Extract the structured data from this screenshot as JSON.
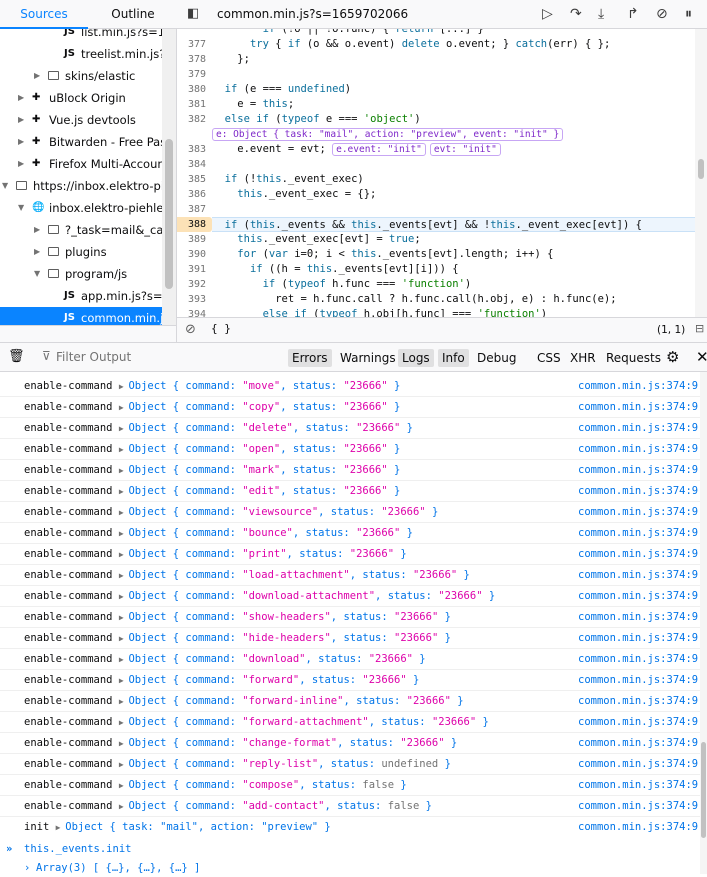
{
  "sidebar": {
    "tabs": {
      "sources": "Sources",
      "outline": "Outline"
    },
    "tree": [
      {
        "label": "list.min.js?s=1",
        "type": "js",
        "depth": 4
      },
      {
        "label": "treelist.min.js?",
        "type": "js",
        "depth": 4
      },
      {
        "label": "skins/elastic",
        "type": "folder",
        "depth": 3
      },
      {
        "label": "uBlock Origin",
        "type": "ext",
        "depth": 2
      },
      {
        "label": "Vue.js devtools",
        "type": "ext",
        "depth": 2
      },
      {
        "label": "Bitwarden - Free Pass",
        "type": "ext",
        "depth": 2
      },
      {
        "label": "Firefox Multi-Accoun",
        "type": "ext",
        "depth": 2
      },
      {
        "label": "https://inbox.elektro-pie",
        "type": "page",
        "depth": 1
      },
      {
        "label": "inbox.elektro-piehler",
        "type": "globe",
        "depth": 2
      },
      {
        "label": "?_task=mail&_cap",
        "type": "folder",
        "depth": 3
      },
      {
        "label": "plugins",
        "type": "folder",
        "depth": 3
      },
      {
        "label": "program/js",
        "type": "folder",
        "depth": 3
      },
      {
        "label": "app.min.js?s=1",
        "type": "js",
        "depth": 4
      },
      {
        "label": "common.min.js",
        "type": "js",
        "depth": 4,
        "selected": true
      }
    ]
  },
  "editor": {
    "file_tab": "common.min.js?s=1659702066",
    "footer_braces": "{ }",
    "cursor_pos": "(1, 1)",
    "lines": [
      {
        "n": "",
        "html": "        <span class='kw'>if</span> (!o || !o.func) { <span class='kw'>return</span> [...] }"
      },
      {
        "n": "377",
        "html": "      <span class='kw'>try</span> { <span class='kw'>if</span> (o && o.event) <span class='kw'>delete</span> o.event; } <span class='kw'>catch</span>(err) { };"
      },
      {
        "n": "378",
        "html": "    };"
      },
      {
        "n": "379",
        "html": ""
      },
      {
        "n": "380",
        "html": "  <span class='kw'>if</span> (e === <span class='kw'>undefined</span>)"
      },
      {
        "n": "381",
        "html": "    e = <span class='kw'>this</span>;"
      },
      {
        "n": "382",
        "html": "  <span class='kw'>else</span> <span class='kw'>if</span> (<span class='kw'>typeof</span> e === <span class='str'>'object'</span>)"
      },
      {
        "n": "",
        "html": "<span class='pill'>e: Object { task: \"mail\", action: \"preview\", event: \"init\" }</span>"
      },
      {
        "n": "383",
        "html": "    e.event = evt; <span class='pill'>e.event: \"init\"</span><span class='pill'>evt: \"init\"</span>"
      },
      {
        "n": "384",
        "html": ""
      },
      {
        "n": "385",
        "html": "  <span class='kw'>if</span> (!<span class='kw'>this</span>._event_exec)"
      },
      {
        "n": "386",
        "html": "    <span class='kw'>this</span>._event_exec = {};"
      },
      {
        "n": "387",
        "html": ""
      },
      {
        "n": "388",
        "html": "  <span class='kw'>if</span> (<span class='kw'>this</span>._events && <span class='kw'>this</span>._events[evt] && !<span class='kw'>this</span>._event_exec[evt]) {",
        "bp": true
      },
      {
        "n": "389",
        "html": "    <span class='kw'>this</span>._event_exec[evt] = <span class='kw'>true</span>;"
      },
      {
        "n": "390",
        "html": "    <span class='kw'>for</span> (<span class='kw'>var</span> i=0; i < <span class='kw'>this</span>._events[evt].length; i++) {"
      },
      {
        "n": "391",
        "html": "      <span class='kw'>if</span> ((h = <span class='kw'>this</span>._events[evt][i])) {"
      },
      {
        "n": "392",
        "html": "        <span class='kw'>if</span> (<span class='kw'>typeof</span> h.func === <span class='str'>'function'</span>)"
      },
      {
        "n": "393",
        "html": "          ret = h.func.call ? h.func.call(h.obj, e) : h.func(e);"
      },
      {
        "n": "394",
        "html": "        <span class='kw'>else</span> <span class='kw'>if</span> (<span class='kw'>typeof</span> h.obj[h.func] === <span class='str'>'function'</span>)"
      }
    ]
  },
  "toolbar": {
    "filter_placeholder": "Filter Output",
    "filters": [
      "Errors",
      "Warnings",
      "Logs",
      "Info",
      "Debug",
      "CSS",
      "XHR",
      "Requests"
    ],
    "active_filters": [
      "Errors",
      "Logs",
      "Info"
    ]
  },
  "console": {
    "source": "common.min.js:374:9",
    "entries": [
      {
        "label": "enable-command",
        "command": "move",
        "status": "\"23666\""
      },
      {
        "label": "enable-command",
        "command": "copy",
        "status": "\"23666\""
      },
      {
        "label": "enable-command",
        "command": "delete",
        "status": "\"23666\""
      },
      {
        "label": "enable-command",
        "command": "open",
        "status": "\"23666\""
      },
      {
        "label": "enable-command",
        "command": "mark",
        "status": "\"23666\""
      },
      {
        "label": "enable-command",
        "command": "edit",
        "status": "\"23666\""
      },
      {
        "label": "enable-command",
        "command": "viewsource",
        "status": "\"23666\""
      },
      {
        "label": "enable-command",
        "command": "bounce",
        "status": "\"23666\""
      },
      {
        "label": "enable-command",
        "command": "print",
        "status": "\"23666\""
      },
      {
        "label": "enable-command",
        "command": "load-attachment",
        "status": "\"23666\""
      },
      {
        "label": "enable-command",
        "command": "download-attachment",
        "status": "\"23666\""
      },
      {
        "label": "enable-command",
        "command": "show-headers",
        "status": "\"23666\""
      },
      {
        "label": "enable-command",
        "command": "hide-headers",
        "status": "\"23666\""
      },
      {
        "label": "enable-command",
        "command": "download",
        "status": "\"23666\""
      },
      {
        "label": "enable-command",
        "command": "forward",
        "status": "\"23666\""
      },
      {
        "label": "enable-command",
        "command": "forward-inline",
        "status": "\"23666\""
      },
      {
        "label": "enable-command",
        "command": "forward-attachment",
        "status": "\"23666\""
      },
      {
        "label": "enable-command",
        "command": "change-format",
        "status": "\"23666\""
      },
      {
        "label": "enable-command",
        "command": "reply-list",
        "status": "undefined"
      },
      {
        "label": "enable-command",
        "command": "compose",
        "status": "false"
      },
      {
        "label": "enable-command",
        "command": "add-contact",
        "status": "false"
      }
    ],
    "init_entry": {
      "label": "init",
      "text": "Object { task: \"mail\", action: \"preview\" }"
    },
    "input_prompt": "»",
    "input_text": "this._events.init",
    "result_text": "Array(3) [ {…}, {…}, {…} ]"
  }
}
